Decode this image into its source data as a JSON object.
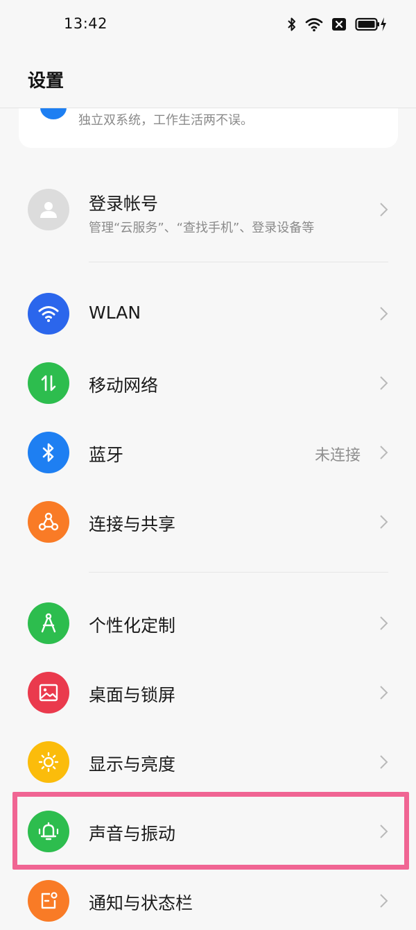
{
  "status_bar": {
    "time": "13:42"
  },
  "header": {
    "title": "设置"
  },
  "top_card": {
    "description": "独立双系统，工作生活两不误。"
  },
  "account": {
    "label": "登录帐号",
    "subtitle": "管理“云服务”、“查找手机”、登录设备等"
  },
  "connectivity": [
    {
      "label": "WLAN",
      "icon": "wifi-icon",
      "color": "#2b66ec"
    },
    {
      "label": "移动网络",
      "icon": "mobile-data-icon",
      "color": "#2dbd4e"
    },
    {
      "label": "蓝牙",
      "icon": "bluetooth-icon",
      "color": "#1e7ff2",
      "value": "未连接"
    },
    {
      "label": "连接与共享",
      "icon": "share-icon",
      "color": "#f97b26"
    }
  ],
  "personal": [
    {
      "label": "个性化定制",
      "icon": "compass-icon",
      "color": "#2dbd4e"
    },
    {
      "label": "桌面与锁屏",
      "icon": "image-icon",
      "color": "#ea3a4d"
    },
    {
      "label": "显示与亮度",
      "icon": "sun-icon",
      "color": "#fbbc0b"
    },
    {
      "label": "声音与振动",
      "icon": "bell-vibrate-icon",
      "color": "#2dbd4e"
    },
    {
      "label": "通知与状态栏",
      "icon": "notification-icon",
      "color": "#f97b26"
    }
  ],
  "highlight_color": "#f06593"
}
